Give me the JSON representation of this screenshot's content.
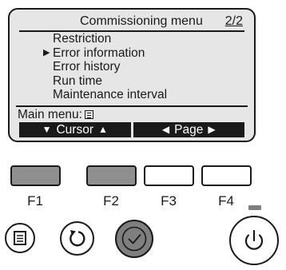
{
  "screen": {
    "title": "Commissioning menu",
    "page": "2/2",
    "selection_marker": "▶",
    "items": [
      {
        "label": "Restriction"
      },
      {
        "label": "Error information"
      },
      {
        "label": "Error history"
      },
      {
        "label": "Run time"
      },
      {
        "label": "Maintenance interval"
      }
    ],
    "selected_index": 1,
    "main_menu_label": "Main menu:",
    "softkeys": [
      {
        "left_glyph": "▼",
        "label": "Cursor",
        "right_glyph": "▲"
      },
      {
        "left_glyph": "◀",
        "label": "Page",
        "right_glyph": "▶"
      }
    ]
  },
  "function_keys": [
    "F1",
    "F2",
    "F3",
    "F4"
  ],
  "icons": {
    "menu": "menu-icon",
    "return": "return-icon",
    "select": "check-icon",
    "power": "power-icon"
  },
  "colors": {
    "lcd_background": "#e6e6e6",
    "softkey_background": "#1a1a1a",
    "function_key_active": "#8f8f8f",
    "select_button": "#7f7f7f",
    "led": "#7f7f7f"
  }
}
